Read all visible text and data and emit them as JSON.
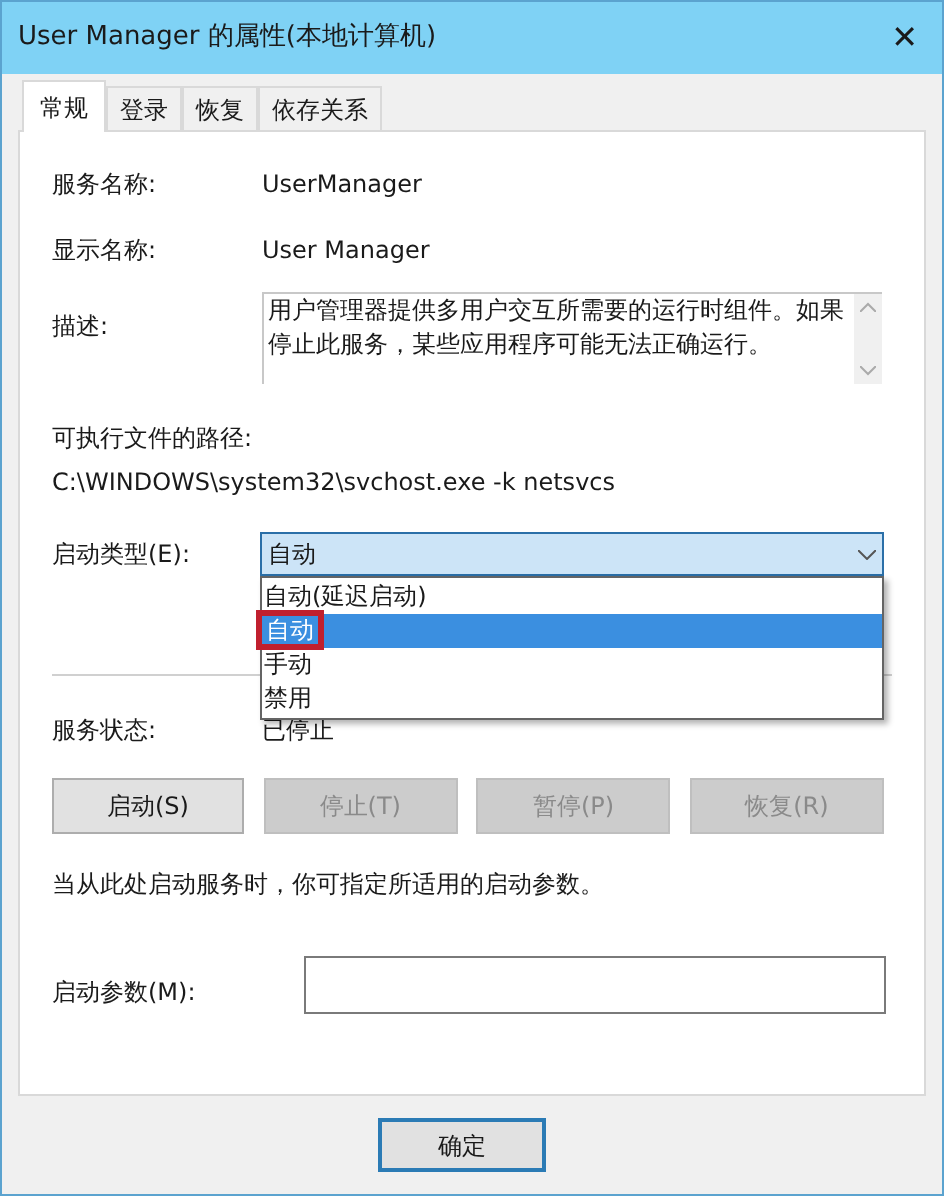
{
  "window": {
    "title": "User Manager 的属性(本地计算机)",
    "close": "✕"
  },
  "tabs": [
    {
      "label": "常规",
      "selected": true
    },
    {
      "label": "登录",
      "selected": false
    },
    {
      "label": "恢复",
      "selected": false
    },
    {
      "label": "依存关系",
      "selected": false
    }
  ],
  "service_name": {
    "label": "服务名称:",
    "value": "UserManager"
  },
  "display_name": {
    "label": "显示名称:",
    "value": "User Manager"
  },
  "description": {
    "label": "描述:",
    "value": "用户管理器提供多用户交互所需要的运行时组件。如果停止此服务，某些应用程序可能无法正确运行。"
  },
  "executable_path": {
    "label": "可执行文件的路径:",
    "value": "C:\\WINDOWS\\system32\\svchost.exe -k netsvcs"
  },
  "startup_type": {
    "label": "启动类型(E):",
    "value": "自动",
    "expanded": true,
    "options": [
      {
        "label": "自动(延迟启动)",
        "selected": false,
        "annotated": false
      },
      {
        "label": "自动",
        "selected": true,
        "annotated": true
      },
      {
        "label": "手动",
        "selected": false,
        "annotated": false
      },
      {
        "label": "禁用",
        "selected": false,
        "annotated": false
      }
    ]
  },
  "service_status": {
    "label": "服务状态:",
    "value": "已停止"
  },
  "service_buttons": [
    {
      "label": "启动(S)",
      "disabled": false
    },
    {
      "label": "停止(T)",
      "disabled": true
    },
    {
      "label": "暂停(P)",
      "disabled": true
    },
    {
      "label": "恢复(R)",
      "disabled": true
    }
  ],
  "hint": "当从此处启动服务时，你可指定所适用的启动参数。",
  "start_parameters": {
    "label": "启动参数(M):"
  },
  "buttons": [
    {
      "label": "确定",
      "default": true
    }
  ]
}
